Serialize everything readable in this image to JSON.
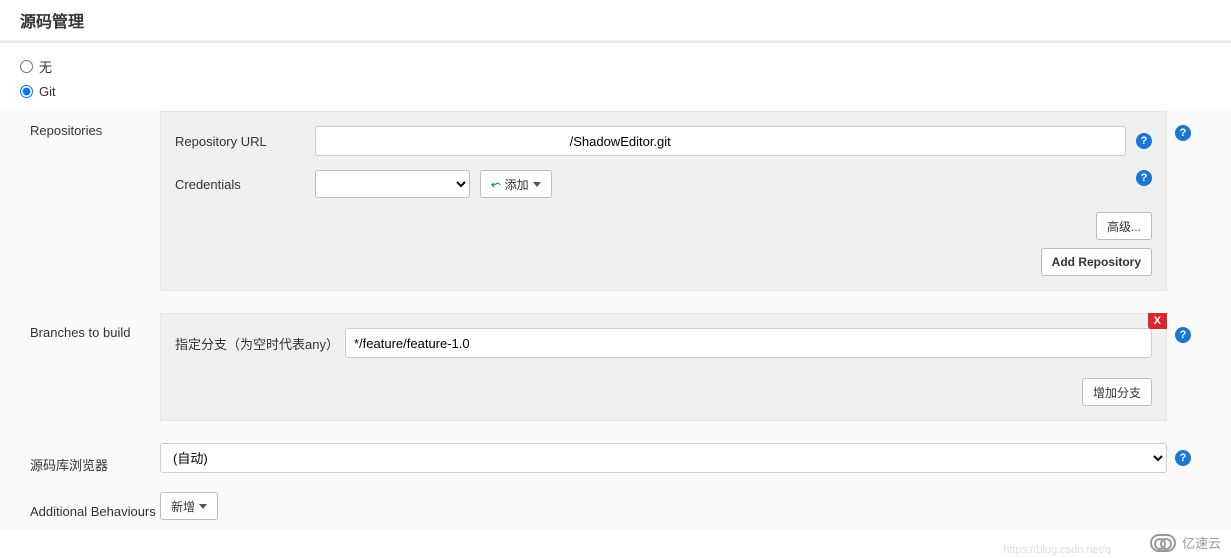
{
  "section_title": "源码管理",
  "scm": {
    "none_label": "无",
    "git_label": "Git",
    "selected": "git"
  },
  "repositories": {
    "label": "Repositories",
    "url_label": "Repository URL",
    "url_value": "                                                                    /ShadowEditor.git",
    "credentials_label": "Credentials",
    "credentials_value": "",
    "add_button": "添加",
    "advanced_button": "高级...",
    "add_repo_button": "Add Repository"
  },
  "branches": {
    "label": "Branches to build",
    "specifier_label": "指定分支（为空时代表any）",
    "specifier_value": "*/feature/feature-1.0",
    "delete_label": "X",
    "add_branch_button": "增加分支"
  },
  "browser": {
    "label": "源码库浏览器",
    "value": "(自动)"
  },
  "behaviours": {
    "label": "Additional Behaviours",
    "add_button": "新增"
  },
  "watermark": {
    "brand": "亿速云",
    "faint": "https://blog.csdn.net/q"
  }
}
